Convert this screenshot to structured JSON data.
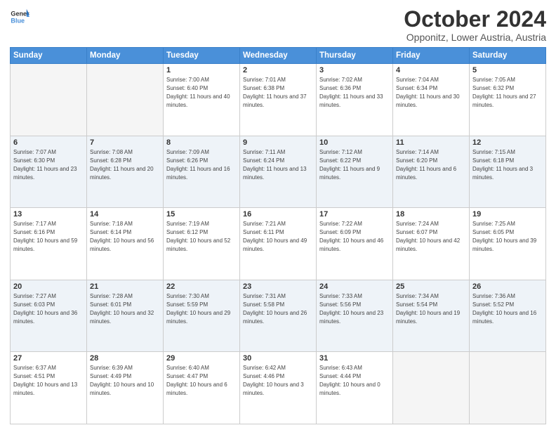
{
  "header": {
    "logo_line1": "General",
    "logo_line2": "Blue",
    "month": "October 2024",
    "location": "Opponitz, Lower Austria, Austria"
  },
  "weekdays": [
    "Sunday",
    "Monday",
    "Tuesday",
    "Wednesday",
    "Thursday",
    "Friday",
    "Saturday"
  ],
  "weeks": [
    [
      {
        "day": "",
        "sunrise": "",
        "sunset": "",
        "daylight": ""
      },
      {
        "day": "",
        "sunrise": "",
        "sunset": "",
        "daylight": ""
      },
      {
        "day": "1",
        "sunrise": "Sunrise: 7:00 AM",
        "sunset": "Sunset: 6:40 PM",
        "daylight": "Daylight: 11 hours and 40 minutes."
      },
      {
        "day": "2",
        "sunrise": "Sunrise: 7:01 AM",
        "sunset": "Sunset: 6:38 PM",
        "daylight": "Daylight: 11 hours and 37 minutes."
      },
      {
        "day": "3",
        "sunrise": "Sunrise: 7:02 AM",
        "sunset": "Sunset: 6:36 PM",
        "daylight": "Daylight: 11 hours and 33 minutes."
      },
      {
        "day": "4",
        "sunrise": "Sunrise: 7:04 AM",
        "sunset": "Sunset: 6:34 PM",
        "daylight": "Daylight: 11 hours and 30 minutes."
      },
      {
        "day": "5",
        "sunrise": "Sunrise: 7:05 AM",
        "sunset": "Sunset: 6:32 PM",
        "daylight": "Daylight: 11 hours and 27 minutes."
      }
    ],
    [
      {
        "day": "6",
        "sunrise": "Sunrise: 7:07 AM",
        "sunset": "Sunset: 6:30 PM",
        "daylight": "Daylight: 11 hours and 23 minutes."
      },
      {
        "day": "7",
        "sunrise": "Sunrise: 7:08 AM",
        "sunset": "Sunset: 6:28 PM",
        "daylight": "Daylight: 11 hours and 20 minutes."
      },
      {
        "day": "8",
        "sunrise": "Sunrise: 7:09 AM",
        "sunset": "Sunset: 6:26 PM",
        "daylight": "Daylight: 11 hours and 16 minutes."
      },
      {
        "day": "9",
        "sunrise": "Sunrise: 7:11 AM",
        "sunset": "Sunset: 6:24 PM",
        "daylight": "Daylight: 11 hours and 13 minutes."
      },
      {
        "day": "10",
        "sunrise": "Sunrise: 7:12 AM",
        "sunset": "Sunset: 6:22 PM",
        "daylight": "Daylight: 11 hours and 9 minutes."
      },
      {
        "day": "11",
        "sunrise": "Sunrise: 7:14 AM",
        "sunset": "Sunset: 6:20 PM",
        "daylight": "Daylight: 11 hours and 6 minutes."
      },
      {
        "day": "12",
        "sunrise": "Sunrise: 7:15 AM",
        "sunset": "Sunset: 6:18 PM",
        "daylight": "Daylight: 11 hours and 3 minutes."
      }
    ],
    [
      {
        "day": "13",
        "sunrise": "Sunrise: 7:17 AM",
        "sunset": "Sunset: 6:16 PM",
        "daylight": "Daylight: 10 hours and 59 minutes."
      },
      {
        "day": "14",
        "sunrise": "Sunrise: 7:18 AM",
        "sunset": "Sunset: 6:14 PM",
        "daylight": "Daylight: 10 hours and 56 minutes."
      },
      {
        "day": "15",
        "sunrise": "Sunrise: 7:19 AM",
        "sunset": "Sunset: 6:12 PM",
        "daylight": "Daylight: 10 hours and 52 minutes."
      },
      {
        "day": "16",
        "sunrise": "Sunrise: 7:21 AM",
        "sunset": "Sunset: 6:11 PM",
        "daylight": "Daylight: 10 hours and 49 minutes."
      },
      {
        "day": "17",
        "sunrise": "Sunrise: 7:22 AM",
        "sunset": "Sunset: 6:09 PM",
        "daylight": "Daylight: 10 hours and 46 minutes."
      },
      {
        "day": "18",
        "sunrise": "Sunrise: 7:24 AM",
        "sunset": "Sunset: 6:07 PM",
        "daylight": "Daylight: 10 hours and 42 minutes."
      },
      {
        "day": "19",
        "sunrise": "Sunrise: 7:25 AM",
        "sunset": "Sunset: 6:05 PM",
        "daylight": "Daylight: 10 hours and 39 minutes."
      }
    ],
    [
      {
        "day": "20",
        "sunrise": "Sunrise: 7:27 AM",
        "sunset": "Sunset: 6:03 PM",
        "daylight": "Daylight: 10 hours and 36 minutes."
      },
      {
        "day": "21",
        "sunrise": "Sunrise: 7:28 AM",
        "sunset": "Sunset: 6:01 PM",
        "daylight": "Daylight: 10 hours and 32 minutes."
      },
      {
        "day": "22",
        "sunrise": "Sunrise: 7:30 AM",
        "sunset": "Sunset: 5:59 PM",
        "daylight": "Daylight: 10 hours and 29 minutes."
      },
      {
        "day": "23",
        "sunrise": "Sunrise: 7:31 AM",
        "sunset": "Sunset: 5:58 PM",
        "daylight": "Daylight: 10 hours and 26 minutes."
      },
      {
        "day": "24",
        "sunrise": "Sunrise: 7:33 AM",
        "sunset": "Sunset: 5:56 PM",
        "daylight": "Daylight: 10 hours and 23 minutes."
      },
      {
        "day": "25",
        "sunrise": "Sunrise: 7:34 AM",
        "sunset": "Sunset: 5:54 PM",
        "daylight": "Daylight: 10 hours and 19 minutes."
      },
      {
        "day": "26",
        "sunrise": "Sunrise: 7:36 AM",
        "sunset": "Sunset: 5:52 PM",
        "daylight": "Daylight: 10 hours and 16 minutes."
      }
    ],
    [
      {
        "day": "27",
        "sunrise": "Sunrise: 6:37 AM",
        "sunset": "Sunset: 4:51 PM",
        "daylight": "Daylight: 10 hours and 13 minutes."
      },
      {
        "day": "28",
        "sunrise": "Sunrise: 6:39 AM",
        "sunset": "Sunset: 4:49 PM",
        "daylight": "Daylight: 10 hours and 10 minutes."
      },
      {
        "day": "29",
        "sunrise": "Sunrise: 6:40 AM",
        "sunset": "Sunset: 4:47 PM",
        "daylight": "Daylight: 10 hours and 6 minutes."
      },
      {
        "day": "30",
        "sunrise": "Sunrise: 6:42 AM",
        "sunset": "Sunset: 4:46 PM",
        "daylight": "Daylight: 10 hours and 3 minutes."
      },
      {
        "day": "31",
        "sunrise": "Sunrise: 6:43 AM",
        "sunset": "Sunset: 4:44 PM",
        "daylight": "Daylight: 10 hours and 0 minutes."
      },
      {
        "day": "",
        "sunrise": "",
        "sunset": "",
        "daylight": ""
      },
      {
        "day": "",
        "sunrise": "",
        "sunset": "",
        "daylight": ""
      }
    ]
  ]
}
